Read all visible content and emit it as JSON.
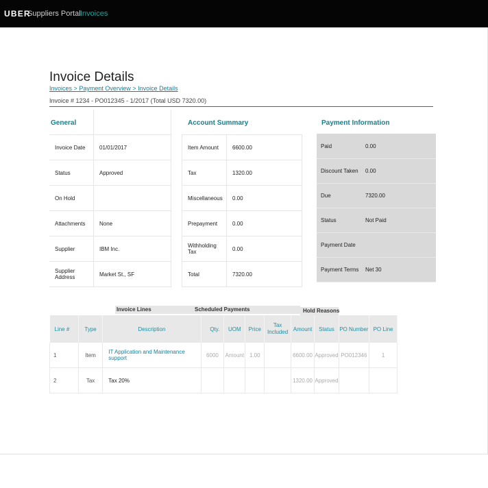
{
  "nav": {
    "brand": "UBER",
    "portal": "Suppliers Portal",
    "current": "Invoices"
  },
  "page": {
    "title": "Invoice Details",
    "breadcrumb": [
      "Invoices",
      "Payment Overview",
      "Invoice Details"
    ],
    "breadcrumb_sep": ">",
    "subtitle": "Invoice # 1234 - PO012345 - 1/2017 (Total USD 7320.00)"
  },
  "general": {
    "heading": "General",
    "rows": [
      {
        "label": "Invoice Date",
        "value": "01/01/2017"
      },
      {
        "label": "Status",
        "value": "Approved"
      },
      {
        "label": "On Hold",
        "value": ""
      },
      {
        "label": "Attachments",
        "value": "None"
      },
      {
        "label": "Supplier",
        "value": "IBM Inc."
      },
      {
        "label": "Supplier Address",
        "value": "Market St., SF"
      }
    ]
  },
  "account_summary": {
    "heading": "Account Summary",
    "rows": [
      {
        "label": "Item Amount",
        "value": "6600.00"
      },
      {
        "label": "Tax",
        "value": "1320.00"
      },
      {
        "label": "Miscellaneous",
        "value": "0.00"
      },
      {
        "label": "Prepayment",
        "value": "0.00"
      },
      {
        "label": "Withholding Tax",
        "value": "0.00"
      },
      {
        "label": "Total",
        "value": "7320.00"
      }
    ]
  },
  "payment_info": {
    "heading": "Payment Information",
    "background": "#d9d9d9",
    "rows": [
      {
        "label": "Paid",
        "value": "0.00"
      },
      {
        "label": "Discount Taken",
        "value": "0.00"
      },
      {
        "label": "Due",
        "value": "7320.00"
      },
      {
        "label": "Status",
        "value": "Not Paid"
      },
      {
        "label": "Payment Date",
        "value": ""
      },
      {
        "label": "Payment Terms",
        "value": "Net 30"
      }
    ]
  },
  "tabs": {
    "invoice_lines": "Invoice Lines",
    "scheduled_payments": "Scheduled Payments",
    "hold_reasons": "Hold Reasons"
  },
  "lines_table": {
    "columns": [
      "Line #",
      "Type",
      "Description",
      "Qty.",
      "UOM",
      "Price",
      "Tax Included",
      "Amount",
      "Status",
      "PO Number",
      "PO Line"
    ],
    "rows": [
      {
        "line": "1",
        "type": "Item",
        "description": "IT Application and Maintenance support",
        "qty": "6000",
        "uom": "Amount",
        "price": "1.00",
        "tax_included": "",
        "amount": "6600.00",
        "status": "Approved",
        "po_number": "PO012346",
        "po_line": "1"
      },
      {
        "line": "2",
        "type": "Tax",
        "description": "Tax 20%",
        "qty": "",
        "uom": "",
        "price": "",
        "tax_included": "",
        "amount": "1320.00",
        "status": "Approved",
        "po_number": "",
        "po_line": ""
      }
    ]
  },
  "colors": {
    "accent": "#117f9c",
    "nav_bg": "#050505",
    "nav_active": "#17a89e"
  }
}
